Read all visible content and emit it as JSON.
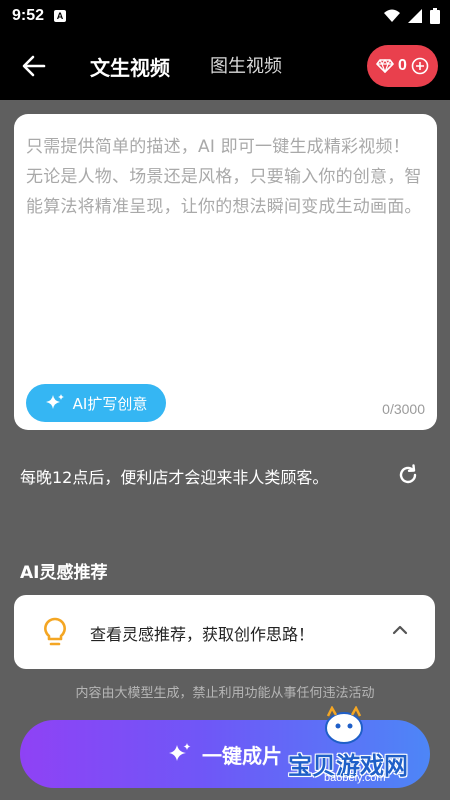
{
  "status_bar": {
    "time": "9:52",
    "notification_letter": "A"
  },
  "header": {
    "tabs": [
      {
        "label": "文生视频",
        "active": true
      },
      {
        "label": "图生视频",
        "active": false
      }
    ],
    "gems": {
      "count": "0",
      "accent": "#e9404d"
    }
  },
  "prompt": {
    "placeholder": "只需提供简单的描述，AI 即可一键生成精彩视频！无论是人物、场景还是风格，只要输入你的创意，智能算法将精准呈现，让你的想法瞬间变成生动画面。",
    "ai_expand_label": "AI扩写创意",
    "char_count": "0/3000",
    "button_color": "#35b6f3"
  },
  "example": {
    "text": "每晚12点后，便利店才会迎来非人类顾客。"
  },
  "inspiration": {
    "title": "AI灵感推荐",
    "card_text": "查看灵感推荐，获取创作思路！"
  },
  "disclaimer": "内容由大模型生成，禁止利用功能从事任何违法活动",
  "generate": {
    "label": "一键成片"
  },
  "watermark": {
    "brand": "宝贝游戏网",
    "url": "baobeiy.com"
  },
  "icons": {
    "back": "arrow-left-icon",
    "gem": "diamond-icon",
    "add": "plus-circle-icon",
    "sparkle": "sparkle-icon",
    "refresh": "refresh-icon",
    "bulb": "lightbulb-icon",
    "chevron": "chevron-up-icon"
  }
}
